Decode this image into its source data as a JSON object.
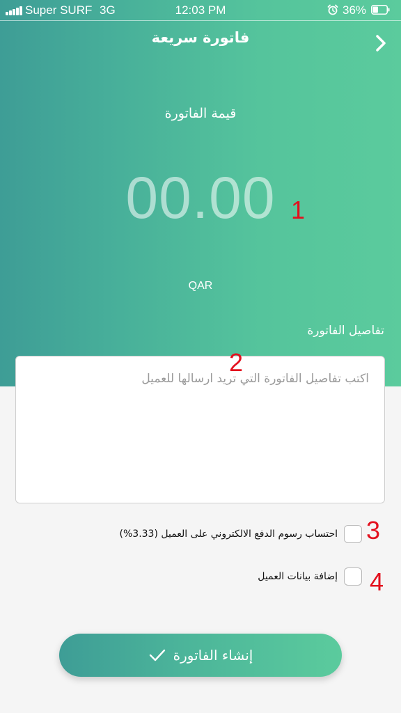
{
  "status_bar": {
    "carrier": "Super SURF",
    "network": "3G",
    "time": "12:03 PM",
    "battery": "36%",
    "icons": [
      "signal-icon",
      "alarm-icon",
      "battery-icon"
    ]
  },
  "nav": {
    "title": "فاتورة سريعة",
    "back_icon": "chevron-right-icon"
  },
  "invoice": {
    "amount_label": "قيمة الفاتورة",
    "amount": "00.00",
    "currency": "QAR",
    "details_label": "تفاصيل الفاتورة",
    "details_placeholder": "اكتب تفاصيل الفاتورة التي تريد ارسالها للعميل",
    "details_value": ""
  },
  "options": [
    {
      "label": "احتساب رسوم الدفع الالكتروني على العميل (3.33%)",
      "checked": false
    },
    {
      "label": "إضافة بيانات العميل",
      "checked": false
    }
  ],
  "submit": {
    "label": "إنشاء الفاتورة",
    "icon": "checkmark-icon"
  },
  "annotations": [
    "1",
    "2",
    "3",
    "4"
  ],
  "colors": {
    "gradient_start": "#3e9d96",
    "gradient_end": "#5bcb9d",
    "annotation": "#e3101e",
    "background": "#f5f5f5"
  }
}
